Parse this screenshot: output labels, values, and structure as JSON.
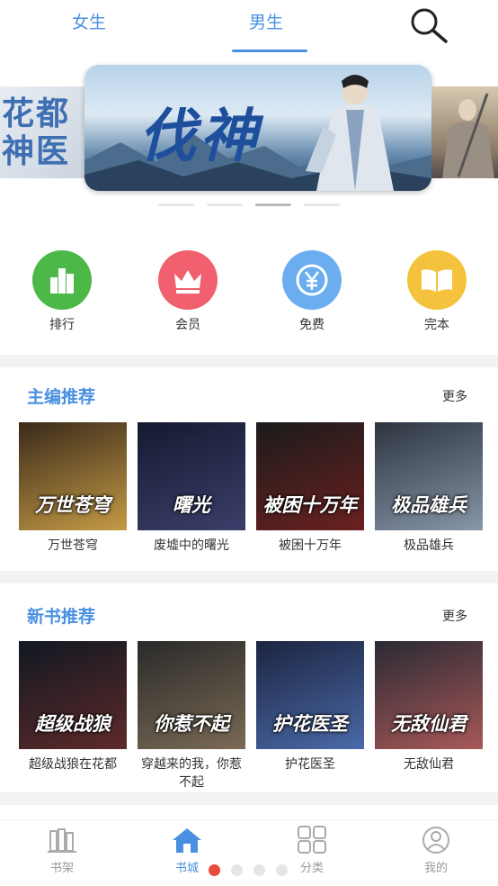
{
  "tabs": {
    "female": "女生",
    "male": "男生",
    "active": "male"
  },
  "banner": {
    "left_title": "花都神医",
    "main_title": "伐神",
    "slides": 4,
    "active_slide": 3
  },
  "quick_entries": [
    {
      "label": "排行",
      "icon": "ranking-icon",
      "color": "#4cb848"
    },
    {
      "label": "会员",
      "icon": "crown-icon",
      "color": "#f0606e"
    },
    {
      "label": "免费",
      "icon": "yen-coin-icon",
      "color": "#6aaef0"
    },
    {
      "label": "完本",
      "icon": "book-open-icon",
      "color": "#f4c23c"
    }
  ],
  "editor_picks": {
    "title": "主编推荐",
    "more": "更多",
    "books": [
      {
        "name": "万世苍穹",
        "cover_text": "万世苍穹",
        "colors": [
          "#3a2a1a",
          "#c49a45"
        ]
      },
      {
        "name": "废墟中的曙光",
        "cover_text": "曙光",
        "colors": [
          "#151a30",
          "#3b3f6a"
        ]
      },
      {
        "name": "被困十万年",
        "cover_text": "被困十万年",
        "colors": [
          "#1b1b1b",
          "#6b2020"
        ]
      },
      {
        "name": "极品雄兵",
        "cover_text": "极品雄兵",
        "colors": [
          "#2d3440",
          "#8796a8"
        ]
      }
    ]
  },
  "new_books": {
    "title": "新书推荐",
    "more": "更多",
    "books": [
      {
        "name": "超级战狼在花都",
        "cover_text": "超级战狼",
        "colors": [
          "#111822",
          "#5e2a2a"
        ]
      },
      {
        "name": "穿越来的我，你惹不起",
        "cover_text": "你惹不起",
        "colors": [
          "#2a2a2a",
          "#7a6a55"
        ]
      },
      {
        "name": "护花医圣",
        "cover_text": "护花医圣",
        "colors": [
          "#1c2440",
          "#4a6aa8"
        ]
      },
      {
        "name": "无敌仙君",
        "cover_text": "无敌仙君",
        "colors": [
          "#2a2a34",
          "#a85858"
        ]
      }
    ]
  },
  "bottom_nav": [
    {
      "label": "书架",
      "icon": "bookshelf-icon",
      "active": false
    },
    {
      "label": "书城",
      "icon": "home-icon",
      "active": true
    },
    {
      "label": "分类",
      "icon": "grid-icon",
      "active": false
    },
    {
      "label": "我的",
      "icon": "user-icon",
      "active": false
    }
  ],
  "pager": {
    "count": 4,
    "active": 1
  },
  "colors": {
    "accent": "#4a90e2",
    "pager_active": "#e94b3c",
    "divider": "#f2f2f2"
  }
}
